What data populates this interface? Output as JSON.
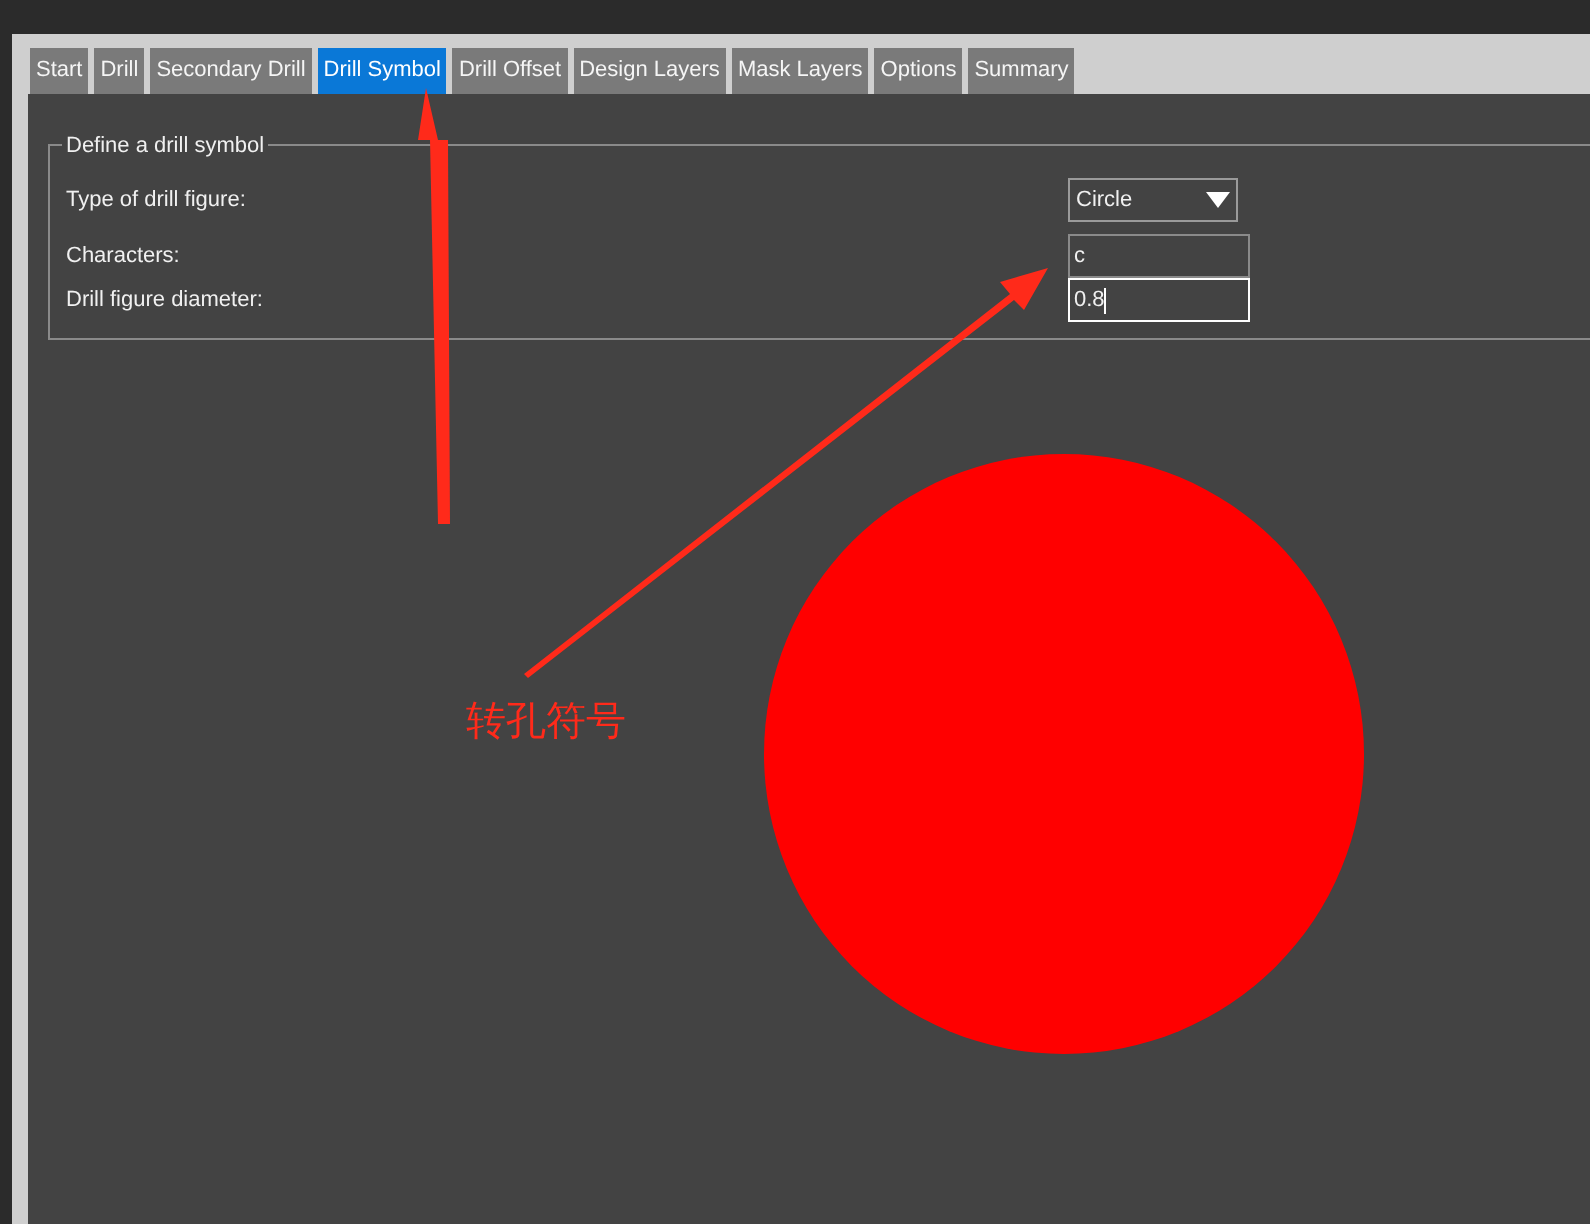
{
  "tabs": [
    {
      "label": "Start",
      "selected": false
    },
    {
      "label": "Drill",
      "selected": false
    },
    {
      "label": "Secondary Drill",
      "selected": false
    },
    {
      "label": "Drill Symbol",
      "selected": true
    },
    {
      "label": "Drill Offset",
      "selected": false
    },
    {
      "label": "Design Layers",
      "selected": false
    },
    {
      "label": "Mask Layers",
      "selected": false
    },
    {
      "label": "Options",
      "selected": false
    },
    {
      "label": "Summary",
      "selected": false
    }
  ],
  "group": {
    "title": "Define a drill symbol",
    "fields": [
      {
        "kind": "select",
        "label": "Type of drill figure:",
        "value": "Circle"
      },
      {
        "kind": "text",
        "label": "Characters:",
        "value": "c",
        "focused": false
      },
      {
        "kind": "text",
        "label": "Drill figure diameter:",
        "value": "0.8",
        "focused": true
      }
    ]
  },
  "preview": {
    "kind": "circle"
  },
  "annotation": {
    "text": "转孔符号"
  }
}
